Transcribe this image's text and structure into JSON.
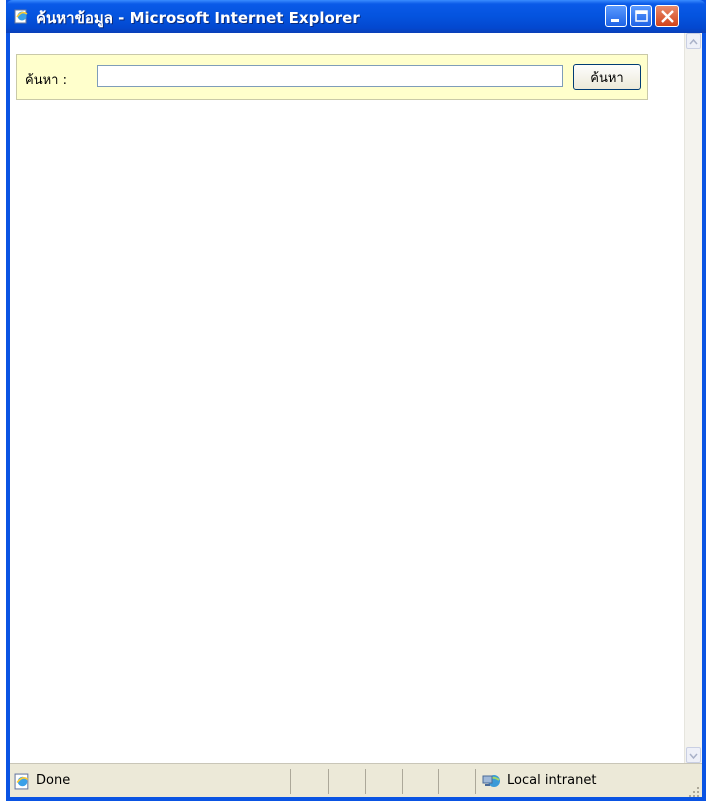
{
  "window": {
    "title": "ค้นหาข้อมูล - Microsoft Internet Explorer"
  },
  "search": {
    "label": "ค้นหา :",
    "value": "",
    "placeholder": "",
    "button_label": "ค้นหา"
  },
  "statusbar": {
    "status_text": "Done",
    "zone_text": "Local intranet"
  },
  "colors": {
    "titlebar": "#0453de",
    "search_bar_bg": "#ffffcc",
    "statusbar_bg": "#ece9d8"
  },
  "icons": {
    "title": "ie-page-icon",
    "status": "ie-page-icon",
    "zone": "local-intranet-icon"
  }
}
